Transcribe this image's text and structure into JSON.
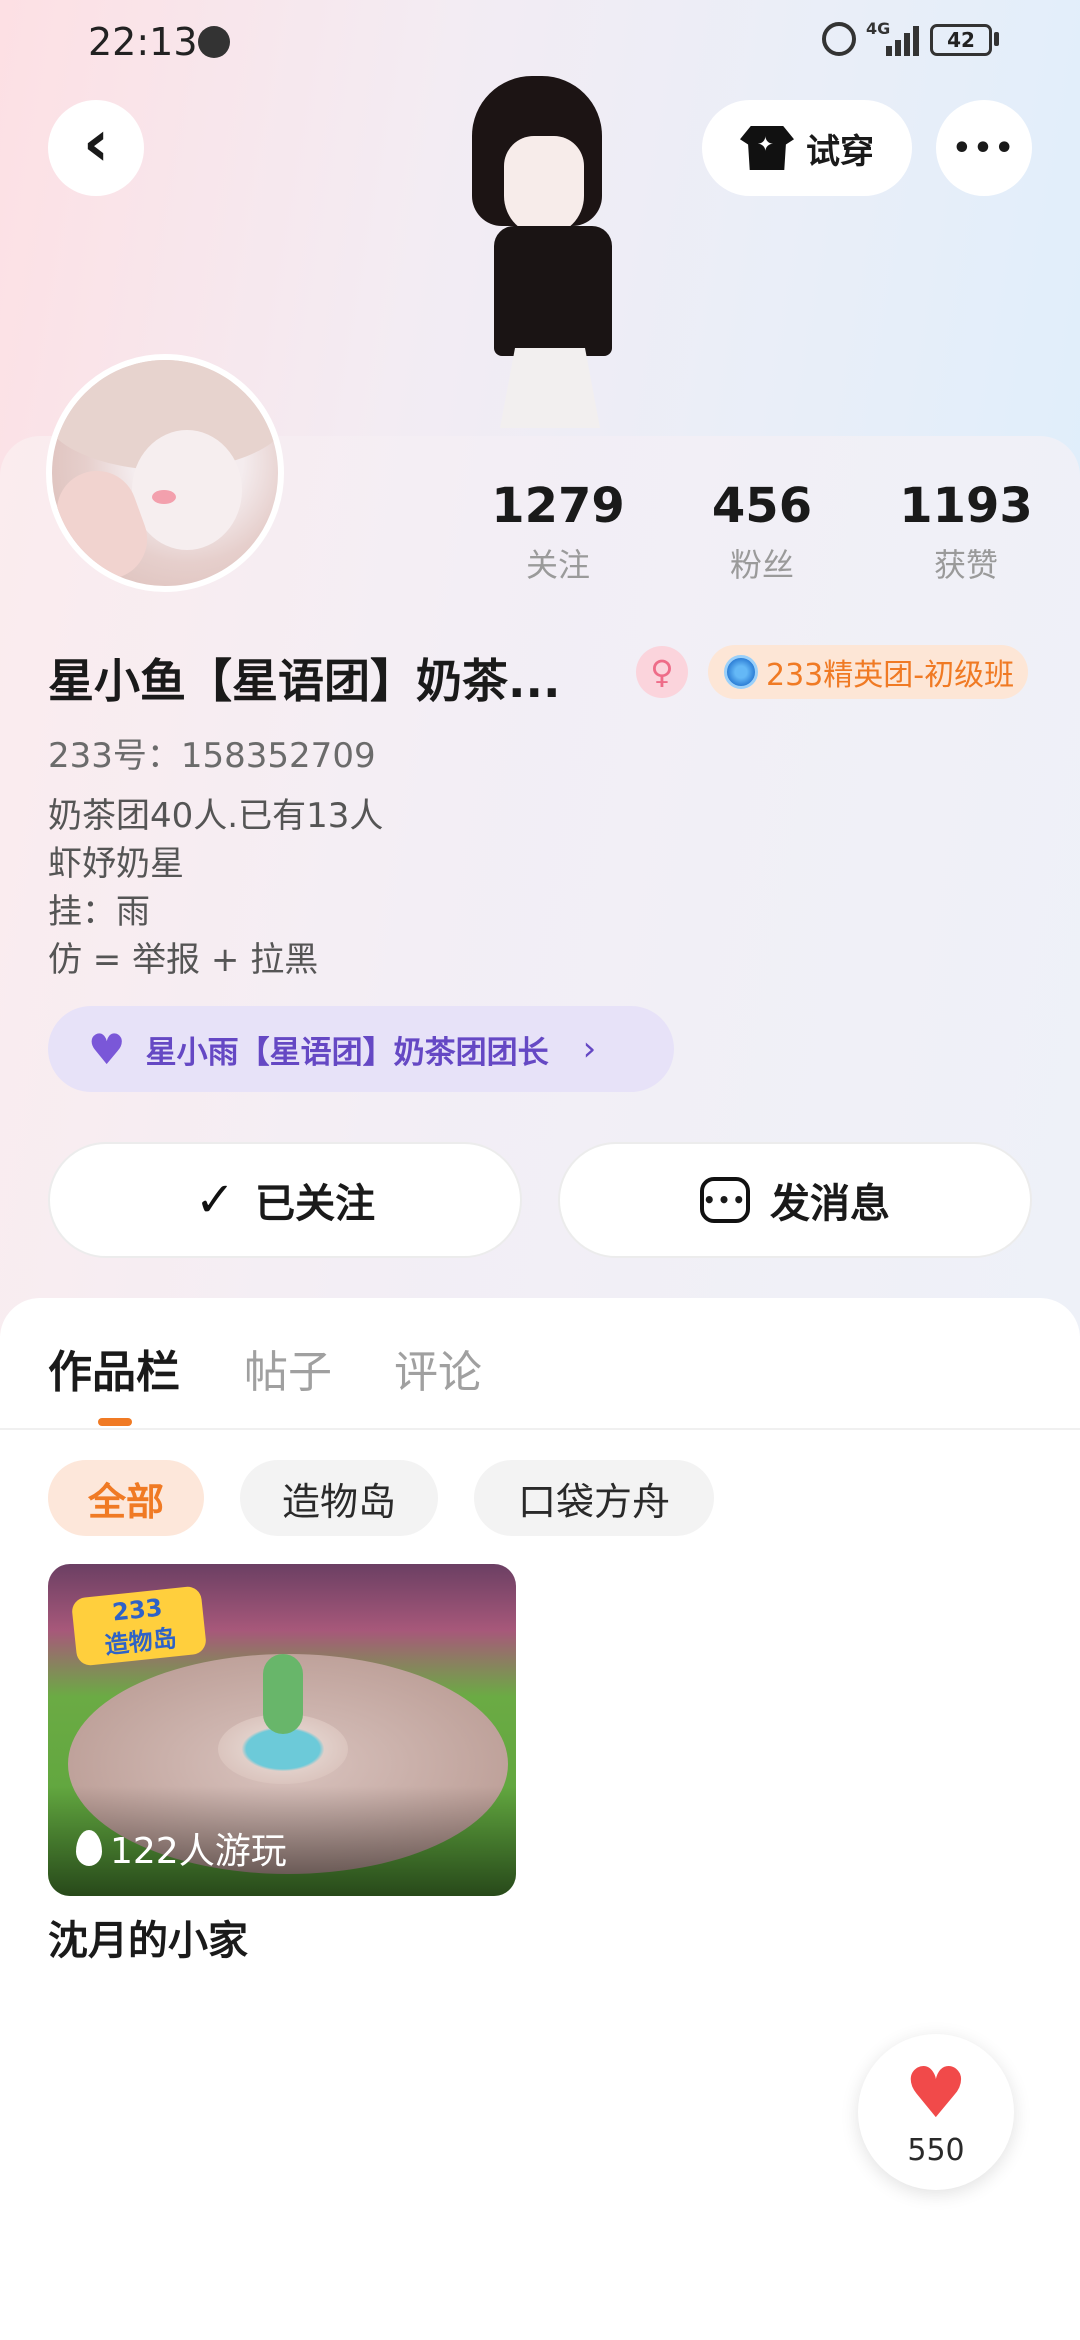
{
  "status_bar": {
    "time": "22:13",
    "network": "4G",
    "battery": "42"
  },
  "header": {
    "tryon_label": "试穿",
    "more_glyph": "•••",
    "back_glyph": "‹"
  },
  "stats": [
    {
      "value": "1279",
      "label": "关注"
    },
    {
      "value": "456",
      "label": "粉丝"
    },
    {
      "value": "1193",
      "label": "获赞"
    }
  ],
  "profile": {
    "username": "星小鱼【星语团】奶茶...",
    "gender_symbol": "♀",
    "group_badge": "233精英团-初级班",
    "uid": "233号：158352709",
    "bio": [
      "奶茶团40人.已有13人",
      "虾妤奶星",
      "挂：雨",
      "仿 = 举报 + 拉黑"
    ],
    "leader_text": "星小雨【星语团】奶茶团团长"
  },
  "actions": {
    "followed_label": "已关注",
    "message_label": "发消息"
  },
  "tabs": [
    {
      "label": "作品栏",
      "active": true
    },
    {
      "label": "帖子",
      "active": false
    },
    {
      "label": "评论",
      "active": false
    }
  ],
  "filters": [
    {
      "label": "全部",
      "active": true
    },
    {
      "label": "造物岛",
      "active": false
    },
    {
      "label": "口袋方舟",
      "active": false
    }
  ],
  "works": [
    {
      "title": "沈月的小家",
      "plays": "122人游玩",
      "logo_text_top": "233",
      "logo_text_bottom": "造物岛"
    }
  ],
  "like_fab": {
    "count": "550"
  },
  "colors": {
    "accent": "#f07a24",
    "leader": "#6548c4",
    "like": "#f14a4a"
  }
}
